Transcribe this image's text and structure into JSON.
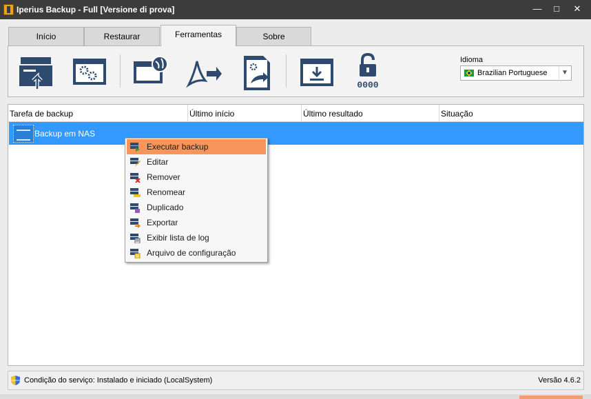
{
  "window": {
    "title": "Iperius Backup - Full  [Versione di prova]",
    "minimize_glyph": "—",
    "maximize_glyph": "□",
    "close_glyph": "✕"
  },
  "tabs": [
    {
      "label": "Início"
    },
    {
      "label": "Restaurar"
    },
    {
      "label": "Ferramentas"
    },
    {
      "label": "Sobre"
    }
  ],
  "active_tab": "Ferramentas",
  "ribbon": {
    "buttons": [
      {
        "icon": "backup-upload-icon"
      },
      {
        "icon": "window-settings-icon"
      },
      {
        "icon": "web-window-icon"
      },
      {
        "icon": "pdf-export-icon"
      },
      {
        "icon": "document-settings-export-icon"
      },
      {
        "icon": "download-window-icon"
      },
      {
        "icon": "lock-pin-icon"
      }
    ],
    "pin_text": "0000",
    "language_label": "Idioma",
    "language_value": "Brazilian Portuguese"
  },
  "table": {
    "columns": [
      "Tarefa de backup",
      "Último início",
      "Último resultado",
      "Situação"
    ],
    "rows": [
      {
        "name": "Backup em NAS",
        "last_start": "",
        "last_result": "",
        "status": ""
      }
    ]
  },
  "context_menu": {
    "items": [
      {
        "label": "Executar backup",
        "icon": "run-backup-icon"
      },
      {
        "label": "Editar",
        "icon": "edit-icon"
      },
      {
        "label": "Remover",
        "icon": "remove-icon"
      },
      {
        "label": "Renomear",
        "icon": "rename-icon"
      },
      {
        "label": "Duplicado",
        "icon": "duplicate-icon"
      },
      {
        "label": "Exportar",
        "icon": "export-icon"
      },
      {
        "label": "Exibir lista de log",
        "icon": "log-list-icon"
      },
      {
        "label": "Arquivo de configuração",
        "icon": "config-file-icon"
      }
    ],
    "highlighted": "Executar backup"
  },
  "statusbar": {
    "service_status": "Condição do serviço: Instalado e iniciado (LocalSystem)",
    "version": "Versão 4.6.2"
  },
  "colors": {
    "titlebar": "#3c3c3c",
    "icon_navy": "#2e4a6e",
    "selection": "#3399ff",
    "menu_highlight": "#f7955b"
  }
}
